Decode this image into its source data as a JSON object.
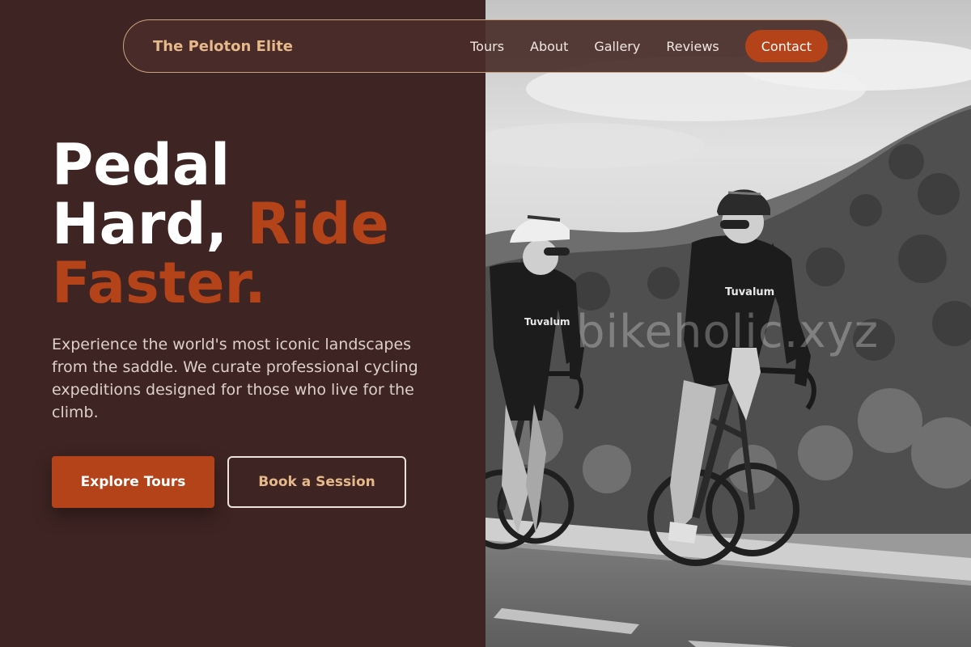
{
  "brand": {
    "name": "The Peloton Elite"
  },
  "nav": {
    "links": [
      "Tours",
      "About",
      "Gallery",
      "Reviews"
    ],
    "contact_label": "Contact"
  },
  "hero": {
    "headline_line1": "Pedal",
    "headline_line2": "Hard, ",
    "headline_accent_1": "Ride",
    "headline_accent_2": "Faster.",
    "subtitle": "Experience the world's most iconic landscapes from the saddle. We curate professional cycling expeditions designed for those who live for the climb.",
    "primary_cta": "Explore Tours",
    "secondary_cta": "Book a Session"
  },
  "photo": {
    "watermark": "bikeholic.xyz",
    "jersey_text": "Tuvalum"
  },
  "colors": {
    "background": "#3e2422",
    "accent": "#b5431a",
    "brand_text": "#e6b98b"
  }
}
